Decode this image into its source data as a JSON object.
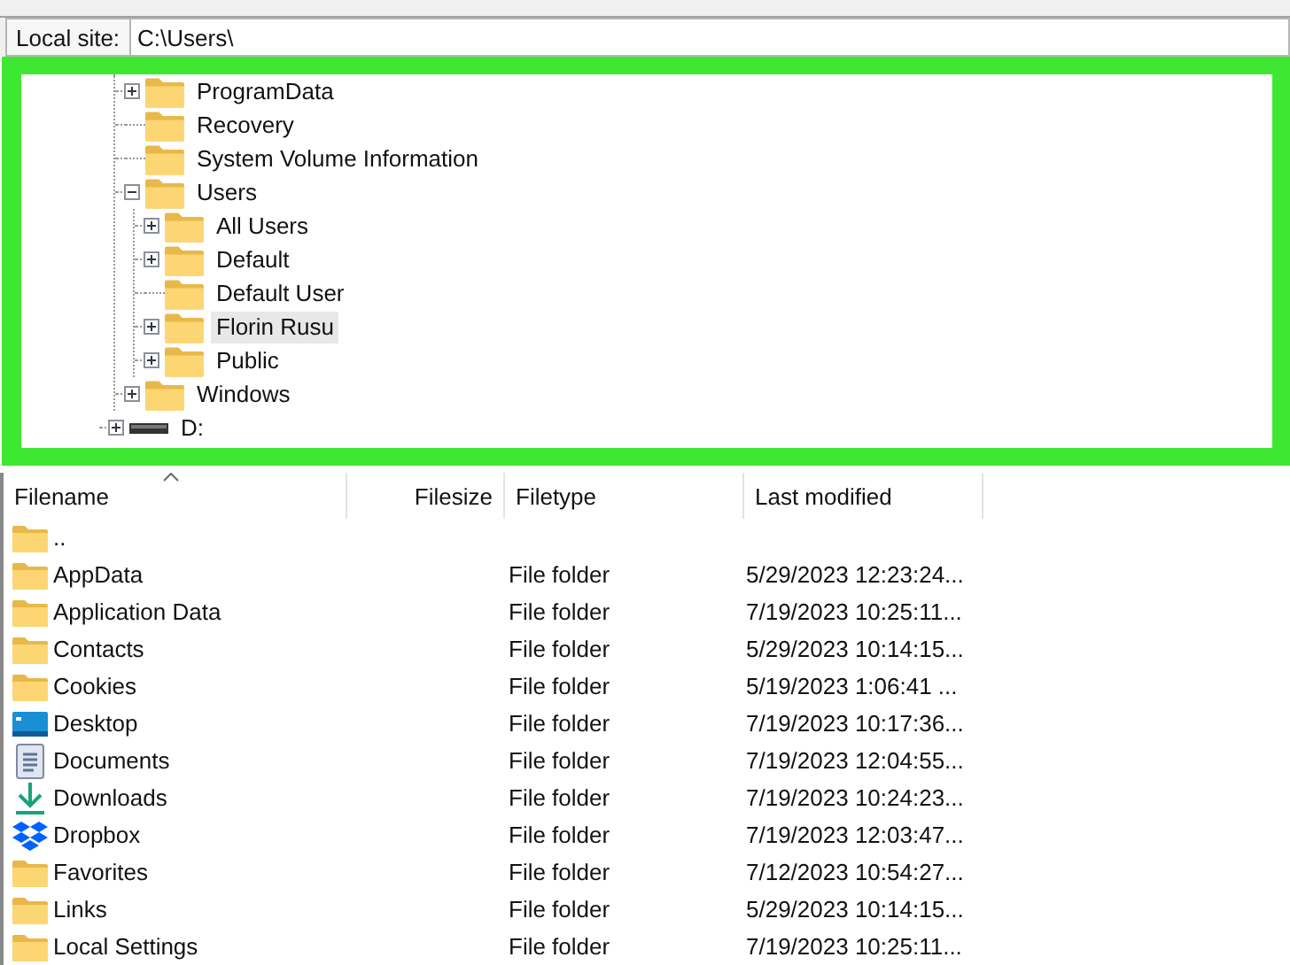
{
  "local_site": {
    "label": "Local site:",
    "value": "C:\\Users\\"
  },
  "tree": {
    "items": [
      {
        "children": [
          {
            "label": "ProgramData",
            "kind": "folder",
            "expanded": false
          },
          {
            "label": "Recovery",
            "kind": "folder"
          },
          {
            "label": "System Volume Information",
            "kind": "folder"
          },
          {
            "label": "Users",
            "kind": "folder",
            "expanded": true,
            "children": [
              {
                "label": "All Users",
                "kind": "folder",
                "expanded": false,
                "highlighted": false
              },
              {
                "label": "Default",
                "kind": "folder",
                "expanded": false,
                "highlighted": false
              },
              {
                "label": "Default User",
                "kind": "folder",
                "highlighted": false
              },
              {
                "label": "Florin Rusu",
                "kind": "folder",
                "expanded": false,
                "highlighted": true
              },
              {
                "label": "Public",
                "kind": "folder",
                "expanded": false,
                "highlighted": false
              }
            ]
          },
          {
            "label": "Windows",
            "kind": "folder",
            "expanded": false
          }
        ]
      },
      {
        "label": "D:",
        "kind": "drive",
        "expanded": false
      }
    ]
  },
  "file_list": {
    "columns": [
      "Filename",
      "Filesize",
      "Filetype",
      "Last modified"
    ],
    "rows": [
      {
        "kind": "folder",
        "name": ".."
      },
      {
        "kind": "folder",
        "name": "AppData",
        "type": "File folder",
        "modified": "5/29/2023 12:23:24..."
      },
      {
        "kind": "folder",
        "name": "Application Data",
        "type": "File folder",
        "modified": "7/19/2023 10:25:11..."
      },
      {
        "kind": "folder",
        "name": "Contacts",
        "type": "File folder",
        "modified": "5/29/2023 10:14:15..."
      },
      {
        "kind": "folder",
        "name": "Cookies",
        "type": "File folder",
        "modified": "5/19/2023 1:06:41 ..."
      },
      {
        "kind": "desktop",
        "name": "Desktop",
        "type": "File folder",
        "modified": "7/19/2023 10:17:36..."
      },
      {
        "kind": "documents",
        "name": "Documents",
        "type": "File folder",
        "modified": "7/19/2023 12:04:55..."
      },
      {
        "kind": "downloads",
        "name": "Downloads",
        "type": "File folder",
        "modified": "7/19/2023 10:24:23..."
      },
      {
        "kind": "dropbox",
        "name": "Dropbox",
        "type": "File folder",
        "modified": "7/19/2023 12:03:47..."
      },
      {
        "kind": "folder",
        "name": "Favorites",
        "type": "File folder",
        "modified": "7/12/2023 10:54:27..."
      },
      {
        "kind": "folder",
        "name": "Links",
        "type": "File folder",
        "modified": "5/29/2023 10:14:15..."
      },
      {
        "kind": "folder",
        "name": "Local Settings",
        "type": "File folder",
        "modified": "7/19/2023 10:25:11..."
      }
    ]
  }
}
